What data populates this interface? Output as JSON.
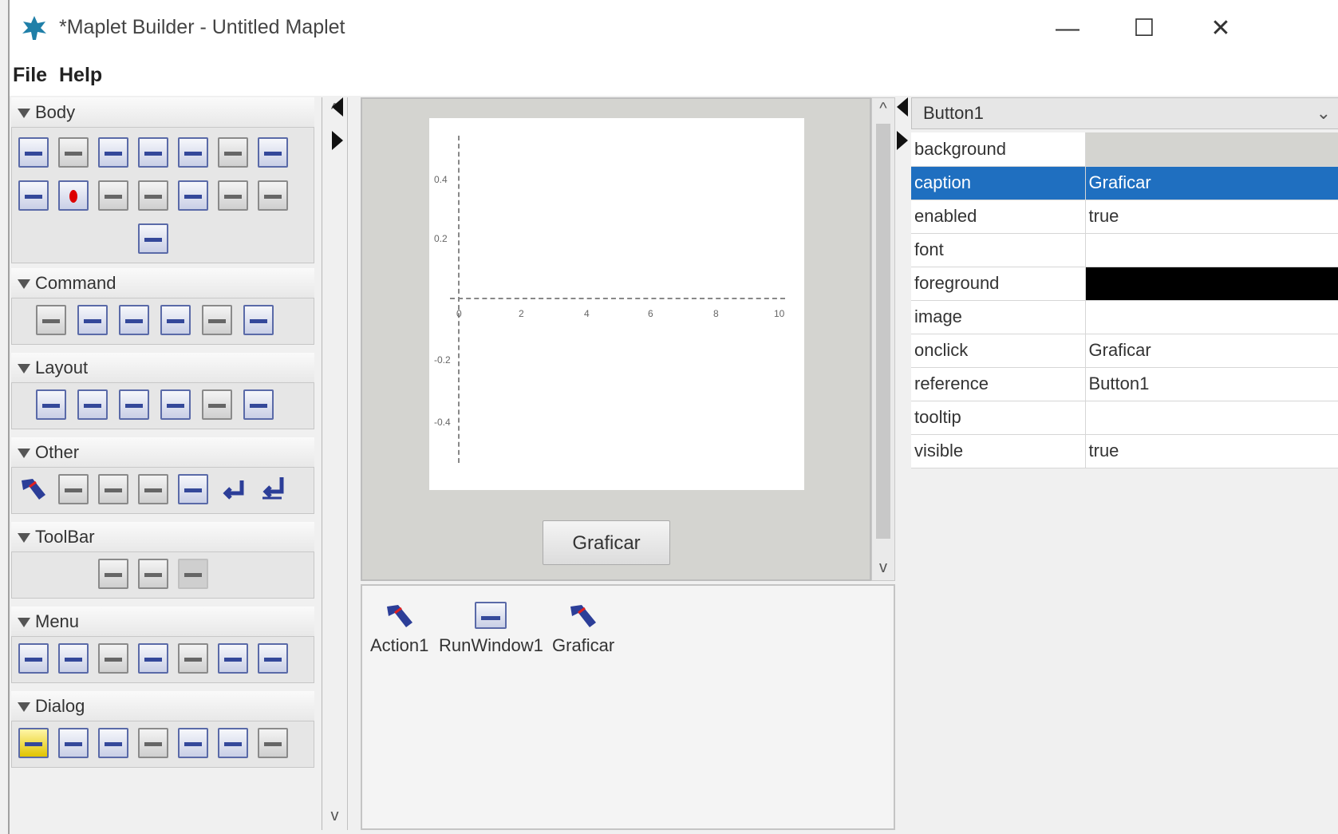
{
  "window": {
    "title": "*Maplet Builder - Untitled Maplet",
    "minimize": "—",
    "maximize": "☐",
    "close": "✕"
  },
  "menu": [
    "File",
    "Help"
  ],
  "palette": {
    "sections": [
      {
        "name": "Body"
      },
      {
        "name": "Command"
      },
      {
        "name": "Layout"
      },
      {
        "name": "Other"
      },
      {
        "name": "ToolBar"
      },
      {
        "name": "Menu"
      },
      {
        "name": "Dialog"
      }
    ],
    "scroll_up": "^",
    "scroll_down": "v"
  },
  "design": {
    "plot": {
      "x_ticks": [
        "0",
        "2",
        "4",
        "6",
        "8",
        "10"
      ],
      "y_ticks": [
        "0.4",
        "0.2",
        "-0.2",
        "-0.4"
      ],
      "zero_label": "0"
    },
    "button_caption": "Graficar"
  },
  "components": [
    {
      "label": "Action1",
      "icon": "action-icon"
    },
    {
      "label": "RunWindow1",
      "icon": "run-window-icon"
    },
    {
      "label": "Graficar",
      "icon": "action-icon"
    }
  ],
  "properties": {
    "selected_element": "Button1",
    "rows": [
      {
        "key": "background",
        "value": "",
        "swatch": "#d4d4d0"
      },
      {
        "key": "caption",
        "value": "Graficar",
        "selected": true
      },
      {
        "key": "enabled",
        "value": "true"
      },
      {
        "key": "font",
        "value": ""
      },
      {
        "key": "foreground",
        "value": "",
        "swatch": "#000000"
      },
      {
        "key": "image",
        "value": ""
      },
      {
        "key": "onclick",
        "value": "Graficar"
      },
      {
        "key": "reference",
        "value": "Button1"
      },
      {
        "key": "tooltip",
        "value": ""
      },
      {
        "key": "visible",
        "value": "true"
      }
    ]
  },
  "colors": {
    "selection": "#1f6fc0",
    "icon_blue": "#34489a"
  }
}
